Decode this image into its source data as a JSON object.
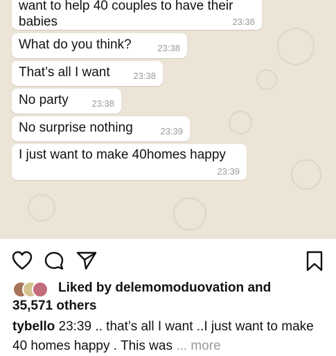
{
  "messages": [
    {
      "text": "want to help 40 couples to have their",
      "time": ""
    },
    {
      "text": "babies",
      "time": "23:38"
    },
    {
      "text": "What do you think?",
      "time": "23:38"
    },
    {
      "text": "That’s all I want",
      "time": "23:38"
    },
    {
      "text": "No party",
      "time": "23:38"
    },
    {
      "text": "No surprise nothing",
      "time": "23:39"
    },
    {
      "text": "I just want to make 40homes happy",
      "time": "23:39"
    }
  ],
  "actions": {
    "like_icon": "heart-icon",
    "comment_icon": "comment-icon",
    "share_icon": "send-icon",
    "save_icon": "bookmark-icon"
  },
  "likes": {
    "prefix": "Liked by",
    "user": "delemomoduovation",
    "and": "and",
    "others": "35,571 others"
  },
  "caption": {
    "username": "tybello",
    "text": "23:39 .. that’s all I want ..I just want to make 40 homes happy . This was",
    "more": "... more"
  }
}
